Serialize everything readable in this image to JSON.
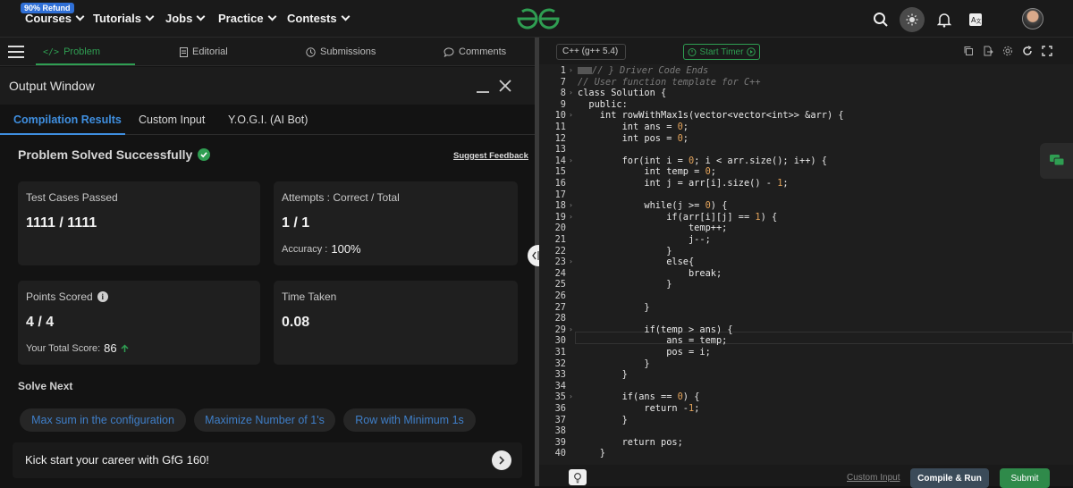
{
  "topnav": {
    "badge": "90% Refund",
    "items": [
      {
        "label": "Courses"
      },
      {
        "label": "Tutorials"
      },
      {
        "label": "Jobs"
      },
      {
        "label": "Practice"
      },
      {
        "label": "Contests"
      }
    ],
    "logo_icon": "gfg-logo",
    "icons": [
      "search-icon",
      "theme-toggle-icon",
      "bell-icon",
      "translate-icon",
      "avatar"
    ]
  },
  "problem_tabs": [
    {
      "label": "Problem",
      "icon": "code-icon",
      "active": true
    },
    {
      "label": "Editorial",
      "icon": "document-icon"
    },
    {
      "label": "Submissions",
      "icon": "clock-icon"
    },
    {
      "label": "Comments",
      "icon": "comment-icon"
    }
  ],
  "output": {
    "title": "Output Window",
    "tabs": [
      {
        "label": "Compilation Results",
        "active": true
      },
      {
        "label": "Custom Input"
      },
      {
        "label": "Y.O.G.I. (AI Bot)"
      }
    ],
    "status": "Problem Solved Successfully",
    "feedback": "Suggest Feedback",
    "cards": {
      "tests": {
        "label": "Test Cases Passed",
        "value": "1111 / 1111"
      },
      "attempts": {
        "label": "Attempts : Correct / Total",
        "value": "1 / 1",
        "sub_label": "Accuracy :",
        "sub_value": "100%"
      },
      "points": {
        "label": "Points Scored",
        "value": "4 / 4",
        "sub_label": "Your Total Score:",
        "sub_value": "86"
      },
      "time": {
        "label": "Time Taken",
        "value": "0.08"
      }
    },
    "solve_next": {
      "title": "Solve Next",
      "items": [
        "Max sum in the configuration",
        "Maximize Number of 1's",
        "Row with Minimum 1s"
      ]
    },
    "banner": "Kick start your career with GfG 160!"
  },
  "editor": {
    "language": "C++ (g++ 5.4)",
    "timer": "Start Timer",
    "colors": {
      "accent": "#2f9e52",
      "number": "#e2a35b",
      "comment": "#7a7a7a"
    },
    "lines": [
      {
        "n": "1",
        "text": "// } Driver Code Ends",
        "kind": "comment"
      },
      {
        "n": "7",
        "text": "// User function template for C++",
        "kind": "comment"
      },
      {
        "n": "8",
        "text": "class Solution {"
      },
      {
        "n": "9",
        "text": "  public:"
      },
      {
        "n": "10",
        "text": "    int rowWithMax1s(vector<vector<int>> &arr) {"
      },
      {
        "n": "11",
        "text": "        int ans = 0;"
      },
      {
        "n": "12",
        "text": "        int pos = 0;"
      },
      {
        "n": "13",
        "text": ""
      },
      {
        "n": "14",
        "text": "        for(int i = 0; i < arr.size(); i++) {"
      },
      {
        "n": "15",
        "text": "            int temp = 0;"
      },
      {
        "n": "16",
        "text": "            int j = arr[i].size() - 1;"
      },
      {
        "n": "17",
        "text": ""
      },
      {
        "n": "18",
        "text": "            while(j >= 0) {"
      },
      {
        "n": "19",
        "text": "                if(arr[i][j] == 1) {"
      },
      {
        "n": "20",
        "text": "                    temp++;"
      },
      {
        "n": "21",
        "text": "                    j--;"
      },
      {
        "n": "22",
        "text": "                }"
      },
      {
        "n": "23",
        "text": "                else{"
      },
      {
        "n": "24",
        "text": "                    break;"
      },
      {
        "n": "25",
        "text": "                }"
      },
      {
        "n": "26",
        "text": ""
      },
      {
        "n": "27",
        "text": "            }"
      },
      {
        "n": "28",
        "text": ""
      },
      {
        "n": "29",
        "text": "            if(temp > ans) {"
      },
      {
        "n": "30",
        "text": "                ans = temp;"
      },
      {
        "n": "31",
        "text": "                pos = i;"
      },
      {
        "n": "32",
        "text": "            }"
      },
      {
        "n": "33",
        "text": "        }"
      },
      {
        "n": "34",
        "text": ""
      },
      {
        "n": "35",
        "text": "        if(ans == 0) {"
      },
      {
        "n": "36",
        "text": "            return -1;"
      },
      {
        "n": "37",
        "text": "        }"
      },
      {
        "n": "38",
        "text": ""
      },
      {
        "n": "39",
        "text": "        return pos;"
      },
      {
        "n": "40",
        "text": "    }"
      }
    ],
    "bottom": {
      "custom_input": "Custom Input",
      "compile": "Compile & Run",
      "submit": "Submit"
    }
  }
}
